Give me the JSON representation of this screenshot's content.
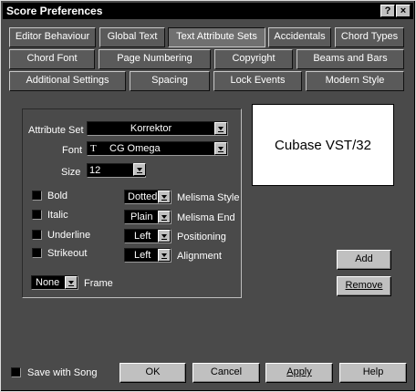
{
  "window": {
    "title": "Score Preferences",
    "help_btn": "?",
    "close_btn": "×"
  },
  "tabs": {
    "row1": [
      "Editor Behaviour",
      "Global Text",
      "Text Attribute Sets",
      "Accidentals",
      "Chord Types"
    ],
    "row2": [
      "Chord Font",
      "Page Numbering",
      "Copyright",
      "Beams and Bars"
    ],
    "row3": [
      "Additional Settings",
      "Spacing",
      "Lock Events",
      "Modern Style"
    ],
    "active": "Text Attribute Sets"
  },
  "form": {
    "attribute_set_label": "Attribute Set",
    "attribute_set_value": "Korrektor",
    "font_label": "Font",
    "font_icon": "T",
    "font_value": "CG Omega",
    "size_label": "Size",
    "size_value": "12",
    "bold_label": "Bold",
    "italic_label": "Italic",
    "underline_label": "Underline",
    "strikeout_label": "Strikeout",
    "melisma_style_value": "Dotted",
    "melisma_style_label": "Melisma Style",
    "melisma_end_value": "Plain",
    "melisma_end_label": "Melisma End",
    "positioning_value": "Left",
    "positioning_label": "Positioning",
    "alignment_value": "Left",
    "alignment_label": "Alignment",
    "frame_value": "None",
    "frame_label": "Frame"
  },
  "preview_text": "Cubase VST/32",
  "side_buttons": {
    "add": "Add",
    "remove": "Remove"
  },
  "footer": {
    "save_with_song": "Save with Song",
    "ok": "OK",
    "cancel": "Cancel",
    "apply": "Apply",
    "help": "Help"
  }
}
